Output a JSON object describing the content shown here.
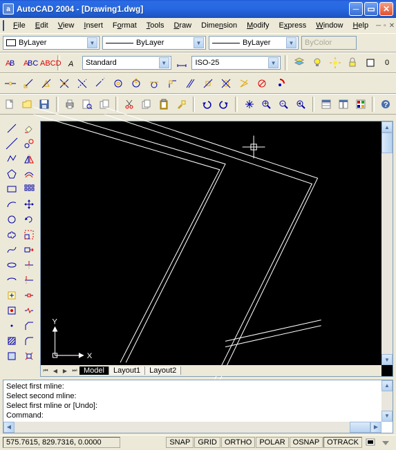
{
  "title": "AutoCAD 2004 - [Drawing1.dwg]",
  "menus": [
    "File",
    "Edit",
    "View",
    "Insert",
    "Format",
    "Tools",
    "Draw",
    "Dimension",
    "Modify",
    "Express",
    "Window",
    "Help"
  ],
  "layer_combo": "ByLayer",
  "linetype_combo": "ByLayer",
  "lineweight_combo": "ByLayer",
  "color_combo": "ByColor",
  "textstyle_combo": "Standard",
  "dimstyle_combo": "ISO-25",
  "layerstate": "0",
  "tabs": {
    "model": "Model",
    "l1": "Layout1",
    "l2": "Layout2"
  },
  "axes": {
    "x": "X",
    "y": "Y"
  },
  "cmd": {
    "l1": "Select first mline:",
    "l2": "Select second mline:",
    "l3": "Select first mline or [Undo]:",
    "l4": "Command:"
  },
  "status": {
    "coords": "575.7615, 829.7316, 0.0000",
    "snap": "SNAP",
    "grid": "GRID",
    "ortho": "ORTHO",
    "polar": "POLAR",
    "osnap": "OSNAP",
    "otrack": "OTRACK"
  }
}
